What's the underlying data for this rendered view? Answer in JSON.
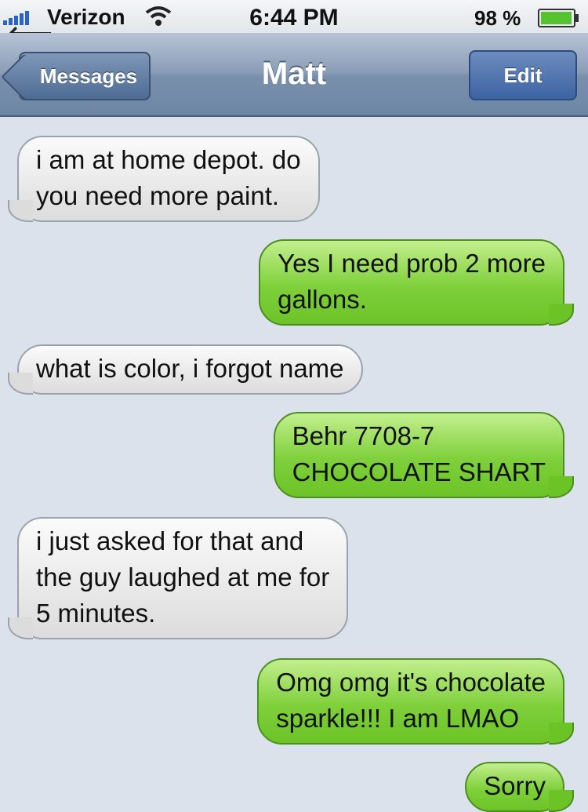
{
  "status_bar": {
    "carrier": "Verizon",
    "time": "6:44 PM",
    "battery": "98 %",
    "battery_level": 0.98,
    "icons": [
      "signal-icon",
      "wifi-icon",
      "battery-icon",
      "back-arrow-icon"
    ]
  },
  "nav": {
    "back_label": "Messages",
    "title": "Matt",
    "edit_label": "Edit"
  },
  "colors": {
    "received_bubble": "#e8e8e8",
    "sent_bubble": "#7fd03b",
    "nav_bar": "#8a9db6",
    "background": "#dbe2ec"
  },
  "messages": [
    {
      "direction": "received",
      "text": "i am at home depot. do\nyou need more paint."
    },
    {
      "direction": "sent",
      "text": "Yes I need prob 2 more\ngallons."
    },
    {
      "direction": "received",
      "text": "what is color, i forgot name"
    },
    {
      "direction": "sent",
      "text": "Behr 7708-7\nCHOCOLATE SHART"
    },
    {
      "direction": "received",
      "text": "i just asked for that and\nthe guy laughed at me for\n5 minutes."
    },
    {
      "direction": "sent",
      "text": "Omg omg it's chocolate\nsparkle!!! I am LMAO"
    },
    {
      "direction": "sent",
      "text": "Sorry"
    }
  ]
}
